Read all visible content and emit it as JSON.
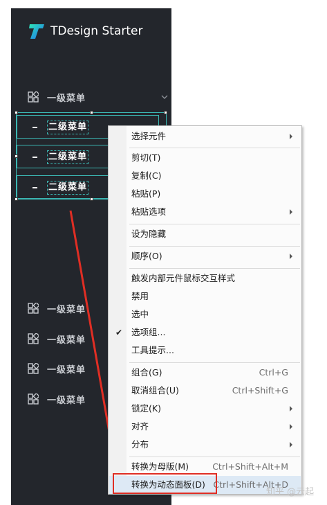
{
  "brand": {
    "name": "TDesign Starter"
  },
  "sidebar": {
    "top_menu": {
      "label": "一级菜单"
    },
    "sub_items": [
      {
        "label": "二级菜单"
      },
      {
        "label": "二级菜单"
      },
      {
        "label": "二级菜单"
      }
    ],
    "lower_menus": [
      {
        "label": "一级菜单"
      },
      {
        "label": "一级菜单"
      },
      {
        "label": "一级菜单"
      },
      {
        "label": "一级菜单"
      }
    ]
  },
  "context_menu": {
    "items": [
      {
        "label": "选择元件",
        "submenu": true
      },
      {
        "label": "剪切(T)"
      },
      {
        "label": "复制(C)"
      },
      {
        "label": "粘贴(P)"
      },
      {
        "label": "粘贴选项",
        "submenu": true
      },
      {
        "label": "设为隐藏"
      },
      {
        "label": "顺序(O)",
        "submenu": true
      },
      {
        "label": "触发内部元件鼠标交互样式"
      },
      {
        "label": "禁用"
      },
      {
        "label": "选中"
      },
      {
        "label": "选项组...",
        "checked": true
      },
      {
        "label": "工具提示..."
      },
      {
        "label": "组合(G)",
        "shortcut": "Ctrl+G"
      },
      {
        "label": "取消组合(U)",
        "shortcut": "Ctrl+Shift+G"
      },
      {
        "label": "锁定(K)",
        "submenu": true
      },
      {
        "label": "对齐",
        "submenu": true
      },
      {
        "label": "分布",
        "submenu": true
      },
      {
        "label": "转换为母版(M)",
        "shortcut": "Ctrl+Shift+Alt+M"
      },
      {
        "label": "转换为动态面板(D)",
        "shortcut": "Ctrl+Shift+Alt+D",
        "highlighted": true
      }
    ]
  },
  "watermark": "知乎 @云起",
  "colors": {
    "sidebar_bg": "#23262c",
    "accent": "#3bb8b4",
    "annotation": "#e02e24",
    "highlight": "#dde9f5"
  }
}
